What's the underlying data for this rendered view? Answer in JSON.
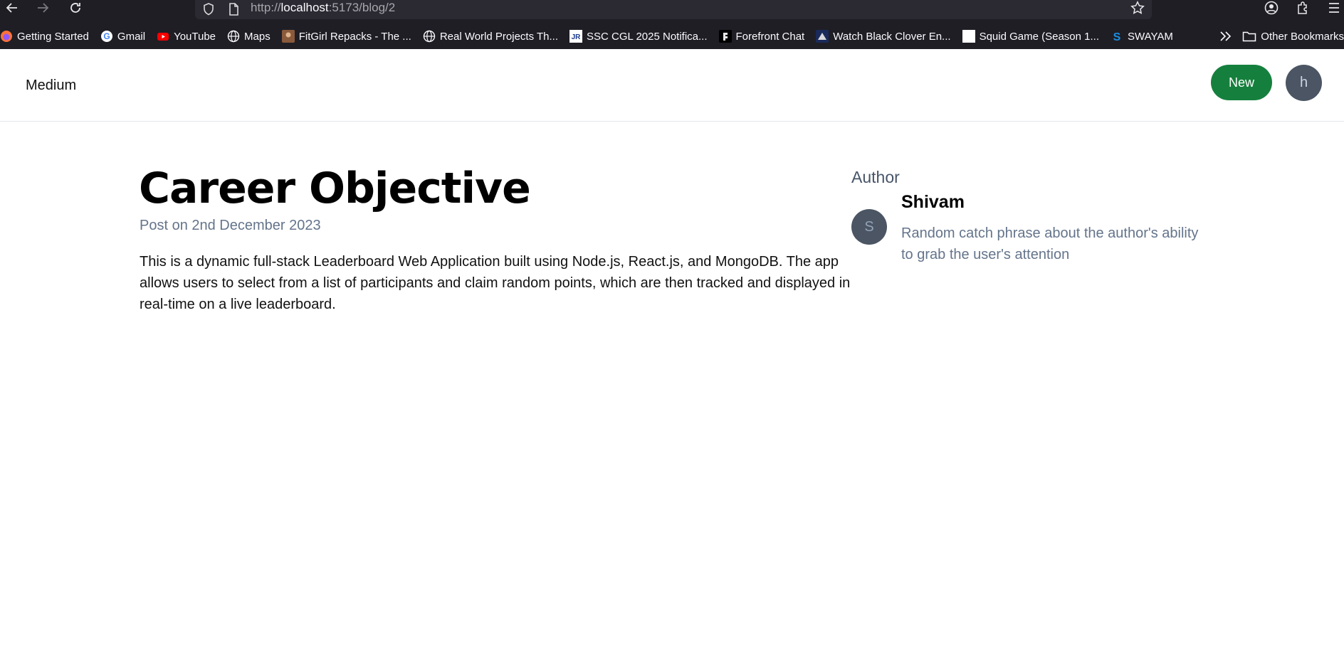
{
  "browser": {
    "url_prefix": "http://",
    "url_host": "localhost",
    "url_path": ":5173/blog/2",
    "bookmarks": [
      {
        "label": "Getting Started",
        "icon": "firefox-icon",
        "color": "#ff7139"
      },
      {
        "label": "Gmail",
        "icon": "google-icon",
        "color": "#ffffff"
      },
      {
        "label": "YouTube",
        "icon": "youtube-icon",
        "color": "#ff0000"
      },
      {
        "label": "Maps",
        "icon": "globe-icon",
        "color": "#1f1e25"
      },
      {
        "label": "FitGirl Repacks - The ...",
        "icon": "fitgirl-icon",
        "color": "#8a5a3c"
      },
      {
        "label": "Real World Projects Th...",
        "icon": "globe-icon",
        "color": "#1f1e25"
      },
      {
        "label": "SSC CGL 2025 Notifica...",
        "icon": "jr-icon",
        "color": "#ffffff"
      },
      {
        "label": "Forefront Chat",
        "icon": "forefront-icon",
        "color": "#000000"
      },
      {
        "label": "Watch Black Clover En...",
        "icon": "anime-icon",
        "color": "#1a2a5a"
      },
      {
        "label": "Squid Game (Season 1...",
        "icon": "blank-page-icon",
        "color": "#ffffff"
      },
      {
        "label": "SWAYAM",
        "icon": "swayam-icon",
        "color": "#1f1e25"
      }
    ],
    "other_bookmarks": "Other Bookmarks"
  },
  "app": {
    "brand": "Medium",
    "new_button": "New",
    "user_initial": "h"
  },
  "post": {
    "title": "Career Objective",
    "date": "Post on 2nd December 2023",
    "content": "This is a dynamic full-stack Leaderboard Web Application built using Node.js, React.js, and MongoDB. The app allows users to select from a list of participants and claim random points, which are then tracked and displayed in real-time on a live leaderboard."
  },
  "author": {
    "label": "Author",
    "initial": "S",
    "name": "Shivam",
    "bio": "Random catch phrase about the author's ability to grab the user's attention"
  }
}
